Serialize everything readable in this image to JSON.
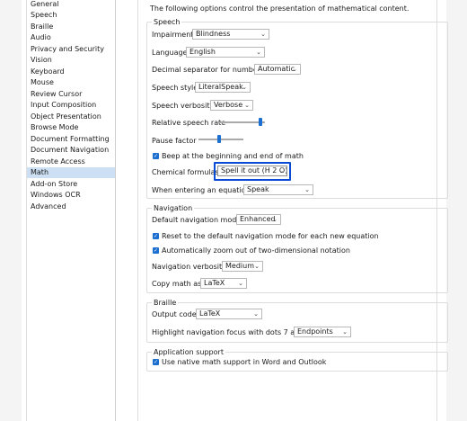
{
  "sidebar": {
    "items": [
      {
        "label": "General"
      },
      {
        "label": "Speech"
      },
      {
        "label": "Braille"
      },
      {
        "label": "Audio"
      },
      {
        "label": "Privacy and Security"
      },
      {
        "label": "Vision"
      },
      {
        "label": "Keyboard"
      },
      {
        "label": "Mouse"
      },
      {
        "label": "Review Cursor"
      },
      {
        "label": "Input Composition"
      },
      {
        "label": "Object Presentation"
      },
      {
        "label": "Browse Mode"
      },
      {
        "label": "Document Formatting"
      },
      {
        "label": "Document Navigation"
      },
      {
        "label": "Remote Access"
      },
      {
        "label": "Math"
      },
      {
        "label": "Add-on Store"
      },
      {
        "label": "Windows OCR"
      },
      {
        "label": "Advanced"
      }
    ],
    "selected": "Math"
  },
  "main": {
    "intro": "The following options control the presentation of mathematical content.",
    "speech": {
      "title": "Speech",
      "impairment_label": "Impairment:",
      "impairment_value": "Blindness",
      "language_label": "Language:",
      "language_value": "English",
      "decimal_label": "Decimal separator for numbers:",
      "decimal_value": "Automatic",
      "style_label": "Speech style:",
      "style_value": "LiteralSpeak",
      "verbosity_label": "Speech verbosity:",
      "verbosity_value": "Verbose",
      "rate_label": "Relative speech rate",
      "rate_level": 0.9,
      "pause_label": "Pause factor",
      "pause_level": 0.45,
      "beep_label": "Beep at the beginning and end of math",
      "beep_checked": true,
      "chem_label": "Chemical formulas:",
      "chem_value": "Spell it out (H 2 O)",
      "equation_label": "When entering an equation:",
      "equation_value": "Speak"
    },
    "navigation": {
      "title": "Navigation",
      "mode_label": "Default navigation mode:",
      "mode_value": "Enhanced",
      "reset_label": "Reset to the default navigation mode for each new equation",
      "reset_checked": true,
      "zoom_label": "Automatically zoom out of two-dimensional notation",
      "zoom_checked": true,
      "verbosity_label": "Navigation verbosity:",
      "verbosity_value": "Medium",
      "copy_label": "Copy math as:",
      "copy_value": "LaTeX"
    },
    "braille": {
      "title": "Braille",
      "output_label": "Output code:",
      "output_value": "LaTeX",
      "highlight_label": "Highlight navigation focus with dots 7 and 8",
      "highlight_value": "Endpoints"
    },
    "appsupport": {
      "title": "Application support",
      "native_label": "Use native math support in Word and Outlook",
      "native_checked": true
    }
  },
  "icons": {
    "chevron": "chevron-down-icon",
    "check": "checkmark-icon"
  },
  "colors": {
    "accent": "#1a6fd0",
    "focus": "#0a4bd6",
    "selection": "#cde0f3"
  }
}
